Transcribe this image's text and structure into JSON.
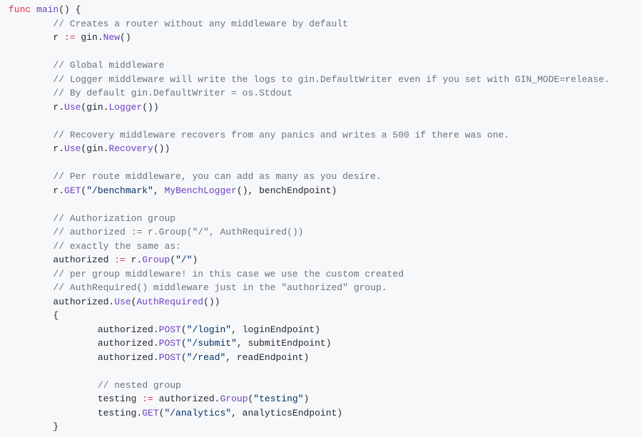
{
  "language": "go",
  "tokens": [
    [
      [
        "kw",
        "func"
      ],
      [
        "id",
        " "
      ],
      [
        "fn",
        "main"
      ],
      [
        "id",
        "() {"
      ]
    ],
    [
      [
        "id",
        "        "
      ],
      [
        "cmt",
        "// Creates a router without any middleware by default"
      ]
    ],
    [
      [
        "id",
        "        r "
      ],
      [
        "kw",
        ":="
      ],
      [
        "id",
        " gin."
      ],
      [
        "fn",
        "New"
      ],
      [
        "id",
        "()"
      ]
    ],
    [],
    [
      [
        "id",
        "        "
      ],
      [
        "cmt",
        "// Global middleware"
      ]
    ],
    [
      [
        "id",
        "        "
      ],
      [
        "cmt",
        "// Logger middleware will write the logs to gin.DefaultWriter even if you set with GIN_MODE=release."
      ]
    ],
    [
      [
        "id",
        "        "
      ],
      [
        "cmt",
        "// By default gin.DefaultWriter = os.Stdout"
      ]
    ],
    [
      [
        "id",
        "        r."
      ],
      [
        "fn",
        "Use"
      ],
      [
        "id",
        "(gin."
      ],
      [
        "fn",
        "Logger"
      ],
      [
        "id",
        "())"
      ]
    ],
    [],
    [
      [
        "id",
        "        "
      ],
      [
        "cmt",
        "// Recovery middleware recovers from any panics and writes a 500 if there was one."
      ]
    ],
    [
      [
        "id",
        "        r."
      ],
      [
        "fn",
        "Use"
      ],
      [
        "id",
        "(gin."
      ],
      [
        "fn",
        "Recovery"
      ],
      [
        "id",
        "())"
      ]
    ],
    [],
    [
      [
        "id",
        "        "
      ],
      [
        "cmt",
        "// Per route middleware, you can add as many as you desire."
      ]
    ],
    [
      [
        "id",
        "        r."
      ],
      [
        "fn",
        "GET"
      ],
      [
        "id",
        "("
      ],
      [
        "str",
        "\"/benchmark\""
      ],
      [
        "id",
        ", "
      ],
      [
        "fn",
        "MyBenchLogger"
      ],
      [
        "id",
        "(), benchEndpoint)"
      ]
    ],
    [],
    [
      [
        "id",
        "        "
      ],
      [
        "cmt",
        "// Authorization group"
      ]
    ],
    [
      [
        "id",
        "        "
      ],
      [
        "cmt",
        "// authorized := r.Group(\"/\", AuthRequired())"
      ]
    ],
    [
      [
        "id",
        "        "
      ],
      [
        "cmt",
        "// exactly the same as:"
      ]
    ],
    [
      [
        "id",
        "        authorized "
      ],
      [
        "kw",
        ":="
      ],
      [
        "id",
        " r."
      ],
      [
        "fn",
        "Group"
      ],
      [
        "id",
        "("
      ],
      [
        "str",
        "\"/\""
      ],
      [
        "id",
        ")"
      ]
    ],
    [
      [
        "id",
        "        "
      ],
      [
        "cmt",
        "// per group middleware! in this case we use the custom created"
      ]
    ],
    [
      [
        "id",
        "        "
      ],
      [
        "cmt",
        "// AuthRequired() middleware just in the \"authorized\" group."
      ]
    ],
    [
      [
        "id",
        "        authorized."
      ],
      [
        "fn",
        "Use"
      ],
      [
        "id",
        "("
      ],
      [
        "fn",
        "AuthRequired"
      ],
      [
        "id",
        "())"
      ]
    ],
    [
      [
        "id",
        "        {"
      ]
    ],
    [
      [
        "id",
        "                authorized."
      ],
      [
        "fn",
        "POST"
      ],
      [
        "id",
        "("
      ],
      [
        "str",
        "\"/login\""
      ],
      [
        "id",
        ", loginEndpoint)"
      ]
    ],
    [
      [
        "id",
        "                authorized."
      ],
      [
        "fn",
        "POST"
      ],
      [
        "id",
        "("
      ],
      [
        "str",
        "\"/submit\""
      ],
      [
        "id",
        ", submitEndpoint)"
      ]
    ],
    [
      [
        "id",
        "                authorized."
      ],
      [
        "fn",
        "POST"
      ],
      [
        "id",
        "("
      ],
      [
        "str",
        "\"/read\""
      ],
      [
        "id",
        ", readEndpoint)"
      ]
    ],
    [],
    [
      [
        "id",
        "                "
      ],
      [
        "cmt",
        "// nested group"
      ]
    ],
    [
      [
        "id",
        "                testing "
      ],
      [
        "kw",
        ":="
      ],
      [
        "id",
        " authorized."
      ],
      [
        "fn",
        "Group"
      ],
      [
        "id",
        "("
      ],
      [
        "str",
        "\"testing\""
      ],
      [
        "id",
        ")"
      ]
    ],
    [
      [
        "id",
        "                testing."
      ],
      [
        "fn",
        "GET"
      ],
      [
        "id",
        "("
      ],
      [
        "str",
        "\"/analytics\""
      ],
      [
        "id",
        ", analyticsEndpoint)"
      ]
    ],
    [
      [
        "id",
        "        }"
      ]
    ]
  ]
}
